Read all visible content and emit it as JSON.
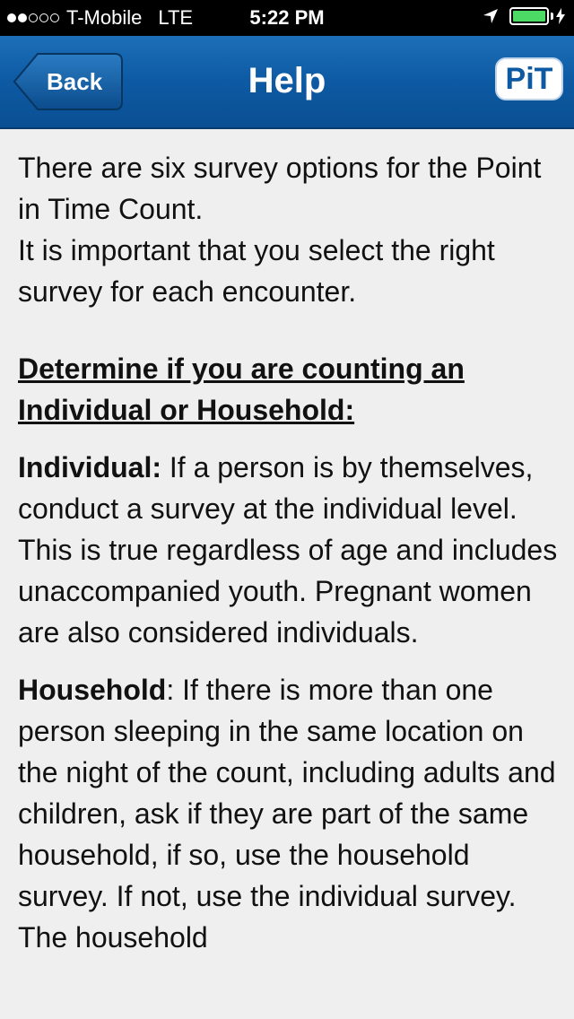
{
  "status_bar": {
    "signal_bars_filled": 2,
    "signal_bars_total": 5,
    "carrier": "T-Mobile",
    "network": "LTE",
    "time": "5:22 PM",
    "battery_level": 1.0
  },
  "nav": {
    "back_label": "Back",
    "title": "Help",
    "logo_text": "PiT"
  },
  "content": {
    "intro_line1": "There are six survey options for the Point in Time Count.",
    "intro_line2": "It is important that you select the right survey for each encounter.",
    "section_heading": "Determine if you are counting an Individual or Household:",
    "individual_term": "Individual:",
    "individual_text": " If a person is by themselves, conduct a survey at the individual level. This is true regardless of age and includes unaccompanied youth. Pregnant women are also considered individuals.",
    "household_term": "Household",
    "household_text": ": If there is more than one person sleeping in the same location on the night of the count, including adults and children, ask if they are part of the same household, if so, use the household survey. If not, use the individual survey. The household"
  },
  "colors": {
    "nav_blue": "#0d5aa3",
    "battery_green": "#4cd964",
    "background": "#efefef"
  }
}
